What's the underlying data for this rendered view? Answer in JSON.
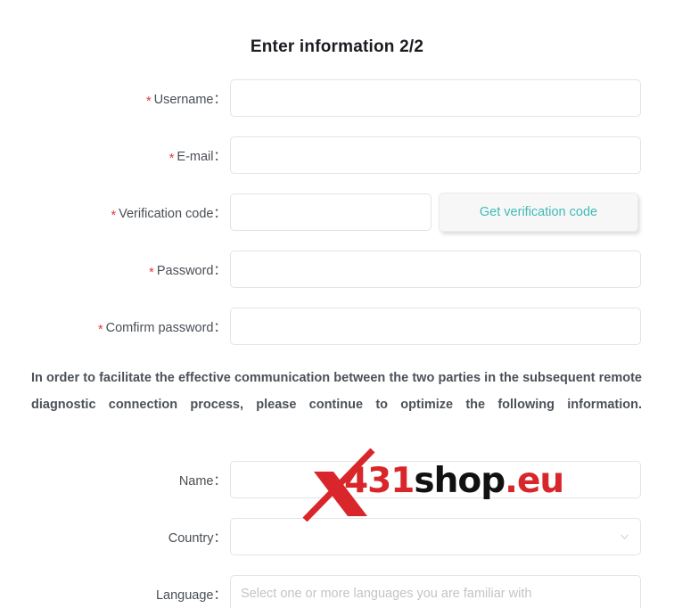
{
  "page": {
    "title": "Enter information 2/2",
    "background": "#ffffff"
  },
  "colors": {
    "required_asterisk": "#e4393c",
    "label_text": "#4a4f55",
    "notice_text": "#4c5159",
    "button_text": "#3fbbb7",
    "input_border": "#e2e4e6",
    "placeholder": "#c2c4c7",
    "watermark_red": "#d8262a",
    "watermark_dark": "#111111"
  },
  "form": {
    "rows": [
      {
        "label": "Username",
        "required": true,
        "value": "",
        "placeholder": ""
      },
      {
        "label": "E-mail",
        "required": true,
        "value": "",
        "placeholder": ""
      },
      {
        "label": "Verification code",
        "required": true,
        "value": "",
        "placeholder": ""
      },
      {
        "label": "Password",
        "required": true,
        "value": "",
        "placeholder": ""
      },
      {
        "label": "Comfirm password",
        "required": true,
        "value": "",
        "placeholder": ""
      }
    ],
    "verification_button": "Get verification code",
    "asterisk": "*",
    "colon": "："
  },
  "notice": {
    "text": "In order to facilitate the effective communication between the two parties in the subsequent remote diagnostic connection process, please continue to optimize the following information."
  },
  "form_lower": {
    "rows": [
      {
        "label": "Name",
        "required": false,
        "value": "",
        "placeholder": "",
        "control": "text"
      },
      {
        "label": "Country",
        "required": false,
        "value": "",
        "placeholder": "",
        "control": "select"
      },
      {
        "label": "Language",
        "required": false,
        "value": "",
        "placeholder": "Select one or more languages you are familiar with",
        "control": "text"
      }
    ]
  },
  "watermark": {
    "part1": "X",
    "part2": "431",
    "part3": "shop",
    "part4": ".eu"
  }
}
